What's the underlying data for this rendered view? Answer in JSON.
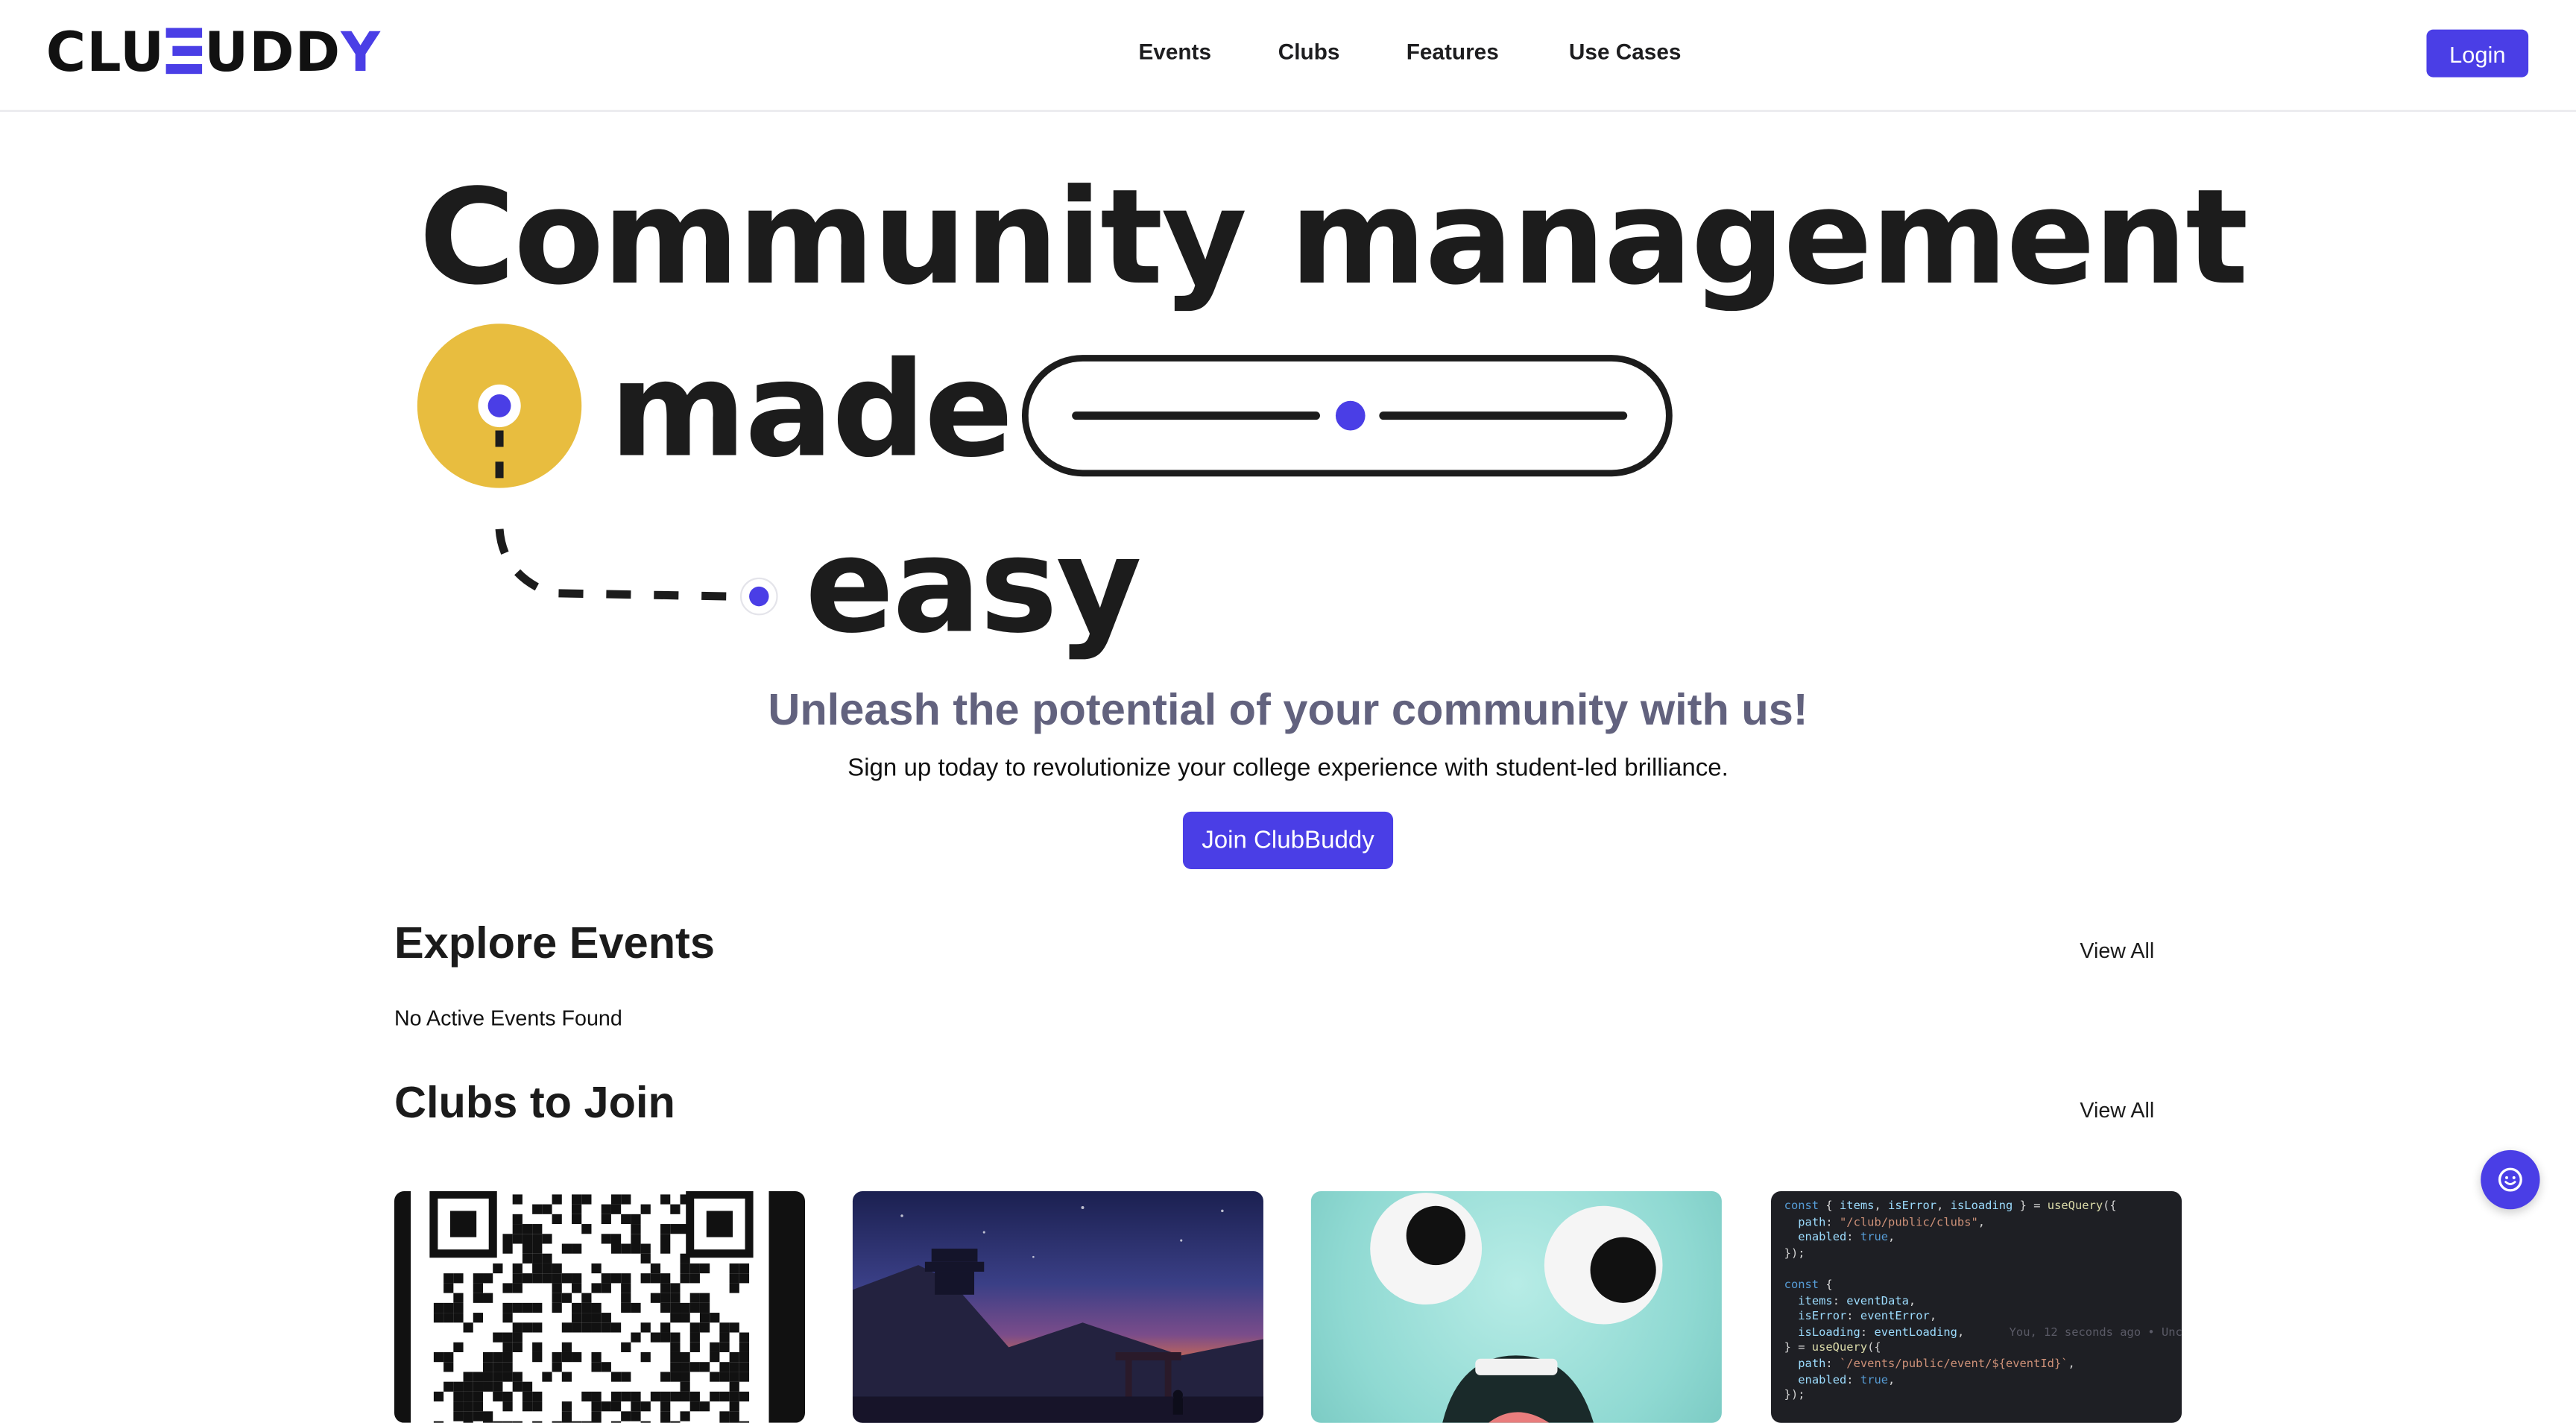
{
  "brand": {
    "logo_pre": "CLU",
    "logo_mid": "UDD",
    "logo_post": "Y",
    "accent_color": "#4a3ee6",
    "yellow": "#e8bd3f"
  },
  "nav": {
    "items": [
      {
        "label": "Events"
      },
      {
        "label": "Clubs"
      },
      {
        "label": "Features"
      },
      {
        "label": "Use Cases"
      }
    ],
    "login_label": "Login"
  },
  "hero": {
    "line1": "Community management",
    "line2": "made",
    "line3": "easy",
    "subhead": "Unleash the potential of your community with us!",
    "subtext": "Sign up today to revolutionize your college experience with student-led brilliance.",
    "cta_label": "Join ClubBuddy"
  },
  "events": {
    "title": "Explore Events",
    "view_all": "View All",
    "empty_message": "No Active Events Found"
  },
  "clubs": {
    "title": "Clubs to Join",
    "view_all": "View All",
    "cards": [
      {
        "image": "qr-code-image"
      },
      {
        "image": "night-temple-image"
      },
      {
        "image": "cartoon-face-image"
      },
      {
        "image": "code-editor-image"
      }
    ],
    "code_lines": [
      "const { items, isError, isLoading } = useQuery({",
      "  path: \"/club/public/clubs\",",
      "  enabled: true,",
      "});",
      "",
      "const {",
      "  items: eventData,",
      "  isError: eventError,",
      "  isLoading: eventLoading,",
      "} = useQuery({",
      "  path: `/events/public/event/${eventId}`,",
      "  enabled: true,",
      "});"
    ],
    "code_blame": "You, 12 seconds ago • Unc"
  },
  "chat": {
    "icon": "smile-chat-icon"
  }
}
